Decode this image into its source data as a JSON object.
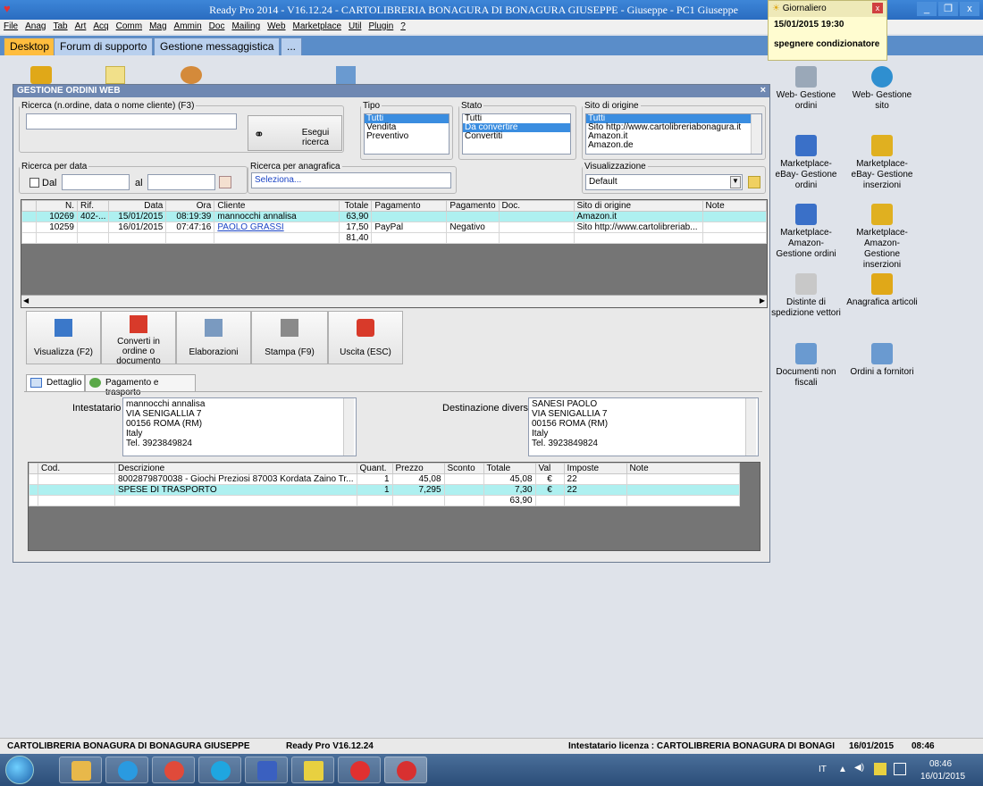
{
  "app": {
    "title": "Ready Pro 2014 - V16.12.24 - CARTOLIBRERIA BONAGURA DI BONAGURA GIUSEPPE - Giuseppe - PC1 Giuseppe",
    "window_controls": [
      "_",
      "❐",
      "x"
    ]
  },
  "menu": [
    "File",
    "Anag",
    "Tab",
    "Art",
    "Acq",
    "Comm",
    "Mag",
    "Ammin",
    "Doc",
    "Mailing",
    "Web",
    "Marketplace",
    "Util",
    "Plugin",
    "?"
  ],
  "tabs": [
    "Desktop",
    "Forum di supporto",
    "Gestione messaggistica",
    "..."
  ],
  "notification": {
    "title": "Giornaliero",
    "datetime": "15/01/2015 19:30",
    "text": "spegnere condizionatore"
  },
  "desktop_icons": [
    {
      "label": "Web- Gestione ordini",
      "color": "#9aa8b8"
    },
    {
      "label": "Web- Gestione sito",
      "color": "#2f8fd0"
    },
    {
      "label": "Marketplace- eBay- Gestione ordini",
      "color": "#3a70c8"
    },
    {
      "label": "Marketplace- eBay- Gestione inserzioni",
      "color": "#e0b020"
    },
    {
      "label": "Marketplace- Amazon- Gestione ordini",
      "color": "#3a70c8"
    },
    {
      "label": "Marketplace- Amazon- Gestione inserzioni",
      "color": "#e0b020"
    },
    {
      "label": "Distinte di spedizione vettori",
      "color": "#c8c8c8"
    },
    {
      "label": "Anagrafica articoli",
      "color": "#e0a818"
    },
    {
      "label": "Documenti non fiscali",
      "color": "#6a9ad0"
    },
    {
      "label": "Ordini a fornitori",
      "color": "#6a9ad0"
    }
  ],
  "window": {
    "title": "GESTIONE ORDINI WEB",
    "search": {
      "legend": "Ricerca (n.ordine, data o nome cliente) (F3)",
      "value": "",
      "button": "Esegui ricerca"
    },
    "tipo": {
      "legend": "Tipo",
      "options": [
        "Tutti",
        "Vendita",
        "Preventivo"
      ],
      "selected": 0
    },
    "stato": {
      "legend": "Stato",
      "options": [
        "Tutti",
        "Da convertire",
        "Convertiti"
      ],
      "selected": 1
    },
    "sito": {
      "legend": "Sito di origine",
      "options": [
        "Tutti",
        "Sito http://www.cartolibreriabonagura.it",
        "Amazon.it",
        "Amazon.de"
      ],
      "selected": 0
    },
    "ricerca_data": {
      "legend": "Ricerca per data",
      "dal_label": "Dal",
      "al_label": "al",
      "dal_value": "",
      "al_value": ""
    },
    "ricerca_anagrafica": {
      "legend": "Ricerca per anagrafica",
      "value": "Seleziona..."
    },
    "visualizzazione": {
      "legend": "Visualizzazione",
      "value": "Default"
    },
    "orders": {
      "columns": [
        "N.",
        "Rif.",
        "Data",
        "Ora",
        "Cliente",
        "Totale",
        "Pagamento",
        "Pagamento",
        "Doc.",
        "Sito di origine",
        "Note"
      ],
      "rows": [
        [
          "10269",
          "402-...",
          "15/01/2015",
          "08:19:39",
          "mannocchi annalisa",
          "63,90",
          "",
          "",
          "",
          "Amazon.it",
          ""
        ],
        [
          "10259",
          "",
          "16/01/2015",
          "07:47:16",
          "PAOLO GRASSI",
          "17,50",
          "PayPal",
          "Negativo",
          "",
          "Sito http://www.cartolibreriab...",
          ""
        ]
      ],
      "total": "81,40"
    },
    "actions": [
      {
        "label": "Visualizza (F2)",
        "color": "#3b78c9"
      },
      {
        "label": "Converti in ordine o documento",
        "color": "#d83a2a"
      },
      {
        "label": "Elaborazioni",
        "color": "#7a9ac0"
      },
      {
        "label": "Stampa (F9)",
        "color": "#8a8a8a"
      },
      {
        "label": "Uscita (ESC)",
        "color": "#d83a2a"
      }
    ],
    "detail_tabs": [
      "Dettaglio",
      "Pagamento e trasporto"
    ],
    "intestatario": {
      "label": "Intestatario :",
      "text": "mannocchi annalisa\nVIA SENIGALLIA 7\n00156 ROMA (RM)\nItaly\nTel. 3923849824"
    },
    "destinazione": {
      "label": "Destinazione diversa :",
      "text": "SANESI PAOLO\nVIA SENIGALLIA 7\n00156 ROMA (RM)\nItaly\nTel. 3923849824"
    },
    "lines": {
      "columns": [
        "Cod.",
        "Descrizione",
        "Quant.",
        "Prezzo",
        "Sconto",
        "Totale",
        "Val",
        "Imposte",
        "Note"
      ],
      "rows": [
        [
          "",
          "8002879870038 - Giochi Preziosi 87003 Kordata Zaino Tr...",
          "1",
          "45,08",
          "",
          "45,08",
          "€",
          "22",
          ""
        ],
        [
          "",
          "SPESE DI TRASPORTO",
          "1",
          "7,295",
          "",
          "7,30",
          "€",
          "22",
          ""
        ]
      ],
      "total": "63,90"
    }
  },
  "status": {
    "company": "CARTOLIBRERIA BONAGURA DI BONAGURA GIUSEPPE",
    "version": "Ready Pro V16.12.24",
    "license": "Intestatario licenza : CARTOLIBRERIA BONAGURA DI BONAGI",
    "date": "16/01/2015",
    "time": "08:46"
  },
  "taskbar": {
    "items": [
      {
        "name": "explorer",
        "color": "#e8b84a"
      },
      {
        "name": "internet-explorer",
        "color": "#2a9ae0"
      },
      {
        "name": "chrome",
        "color": "#e04a3a"
      },
      {
        "name": "skype",
        "color": "#1fa6e0"
      },
      {
        "name": "app-blue",
        "color": "#3a60c0"
      },
      {
        "name": "mr-book",
        "color": "#e8d040"
      },
      {
        "name": "red-cross-app",
        "color": "#e03030"
      },
      {
        "name": "ready-pro",
        "color": "#d83030"
      }
    ],
    "lang": "IT",
    "time": "08:46",
    "date": "16/01/2015"
  }
}
